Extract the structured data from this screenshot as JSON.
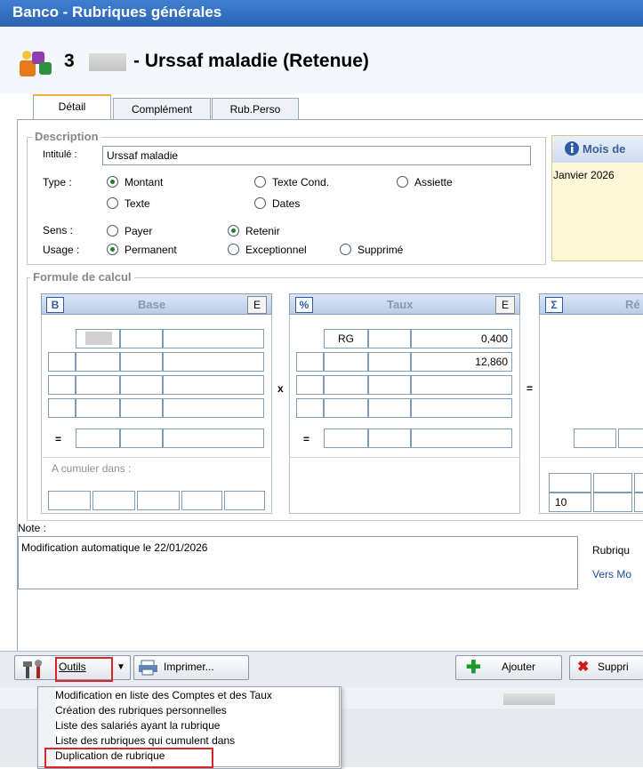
{
  "window": {
    "title": "Banco - Rubriques générales"
  },
  "header": {
    "number": "3",
    "title": "- Urssaf maladie (Retenue)"
  },
  "tabs": [
    "Détail",
    "Complément",
    "Rub.Perso"
  ],
  "description": {
    "group_title": "Description",
    "intitule_label": "Intitulé :",
    "intitule_value": "Urssaf maladie",
    "type_label": "Type :",
    "type_options": [
      "Montant",
      "Texte Cond.",
      "Assiette",
      "Texte",
      "Dates"
    ],
    "sens_label": "Sens :",
    "sens_options": [
      "Payer",
      "Retenir"
    ],
    "usage_label": "Usage :",
    "usage_options": [
      "Permanent",
      "Exceptionnel",
      "Supprimé"
    ]
  },
  "mois": {
    "title": "Mois de",
    "value": "Janvier 2026"
  },
  "formule": {
    "group_title": "Formule de calcul",
    "base": {
      "title": "Base",
      "icon": "B",
      "e_label": "E",
      "equal": "=",
      "cumuler_label": "A cumuler dans :"
    },
    "taux": {
      "title": "Taux",
      "icon": "%",
      "e_label": "E",
      "equal": "=",
      "row1_code": "RG",
      "row1_value": "0,400",
      "row2_value": "12,860"
    },
    "resultat": {
      "title": "Ré",
      "icon": "Σ",
      "bottom_value": "10"
    },
    "times": "x",
    "equals": "="
  },
  "note": {
    "label": "Note :",
    "value": "Modification automatique le 22/01/2026",
    "rubrique_label": "Rubriqu",
    "vers_link": "Vers Mo"
  },
  "toolbar": {
    "outils": "Outils",
    "imprimer": "Imprimer...",
    "ajouter": "Ajouter",
    "supprimer": "Suppri"
  },
  "menu": {
    "items": [
      "Modification en liste des Comptes et des Taux",
      "Création des rubriques personnelles",
      "Liste des salariés ayant la rubrique",
      "Liste des rubriques qui cumulent dans",
      "Duplication de rubrique"
    ]
  },
  "colors": {
    "title_bar": "#2b63b3",
    "highlight": "#d8242a",
    "link": "#1a4fa0"
  }
}
